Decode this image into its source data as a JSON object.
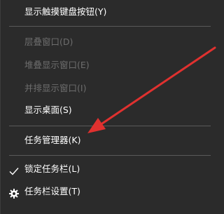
{
  "menu": {
    "items": [
      {
        "label": "显示触摸键盘按钮(Y)",
        "enabled": true
      },
      {
        "label": "层叠窗口(D)",
        "enabled": false
      },
      {
        "label": "堆叠显示窗口(E)",
        "enabled": false
      },
      {
        "label": "并排显示窗口(I)",
        "enabled": false
      },
      {
        "label": "显示桌面(S)",
        "enabled": true
      },
      {
        "label": "任务管理器(K)",
        "enabled": true
      },
      {
        "label": "锁定任务栏(L)",
        "enabled": true,
        "checked": true,
        "icon": "check-icon"
      },
      {
        "label": "任务栏设置(T)",
        "enabled": true,
        "icon": "gear-icon"
      }
    ]
  },
  "annotation": {
    "arrow_color": "#e0312f",
    "target": "任务管理器(K)"
  },
  "colors": {
    "background": "#2b2b2b",
    "text": "#ffffff",
    "disabled_text": "#6d6d6d",
    "separator": "#5a5a5a"
  }
}
